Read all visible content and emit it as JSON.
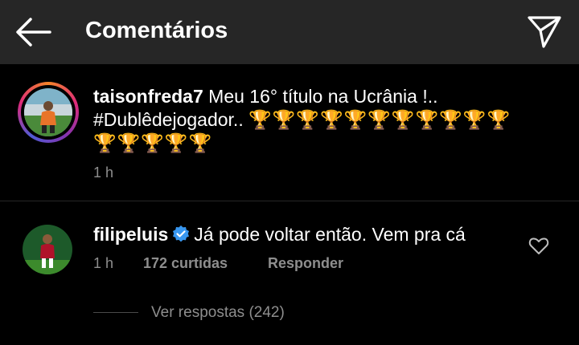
{
  "header": {
    "title": "Comentários",
    "back_icon": "arrow-left-icon",
    "send_icon": "paper-plane-icon"
  },
  "post": {
    "username": "taisonfreda7",
    "caption_text": " Meu 16° título na Ucrânia !..",
    "hashtag": "#Dublêdejogador..",
    "trophies_line1": "🏆🏆🏆🏆🏆🏆🏆🏆🏆🏆🏆",
    "trophies_line2": "🏆🏆🏆🏆🏆",
    "time": "1 h",
    "avatar_icon": "profile-photo-icon",
    "avatar_ring_colors": [
      "#f58529",
      "#dd2a7b",
      "#8134af",
      "#515bd4"
    ]
  },
  "comment": {
    "username": "filipeluis",
    "verified_icon": "verified-badge-icon",
    "verified_color": "#3897f0",
    "text": "Já pode voltar então. Vem pra cá",
    "time": "1 h",
    "likes": "172 curtidas",
    "reply_label": "Responder",
    "like_icon": "heart-outline-icon"
  },
  "replies": {
    "label": "Ver respostas (242)"
  },
  "colors": {
    "background": "#000000",
    "header_bg": "#262626",
    "secondary_text": "#8e8e8e"
  }
}
